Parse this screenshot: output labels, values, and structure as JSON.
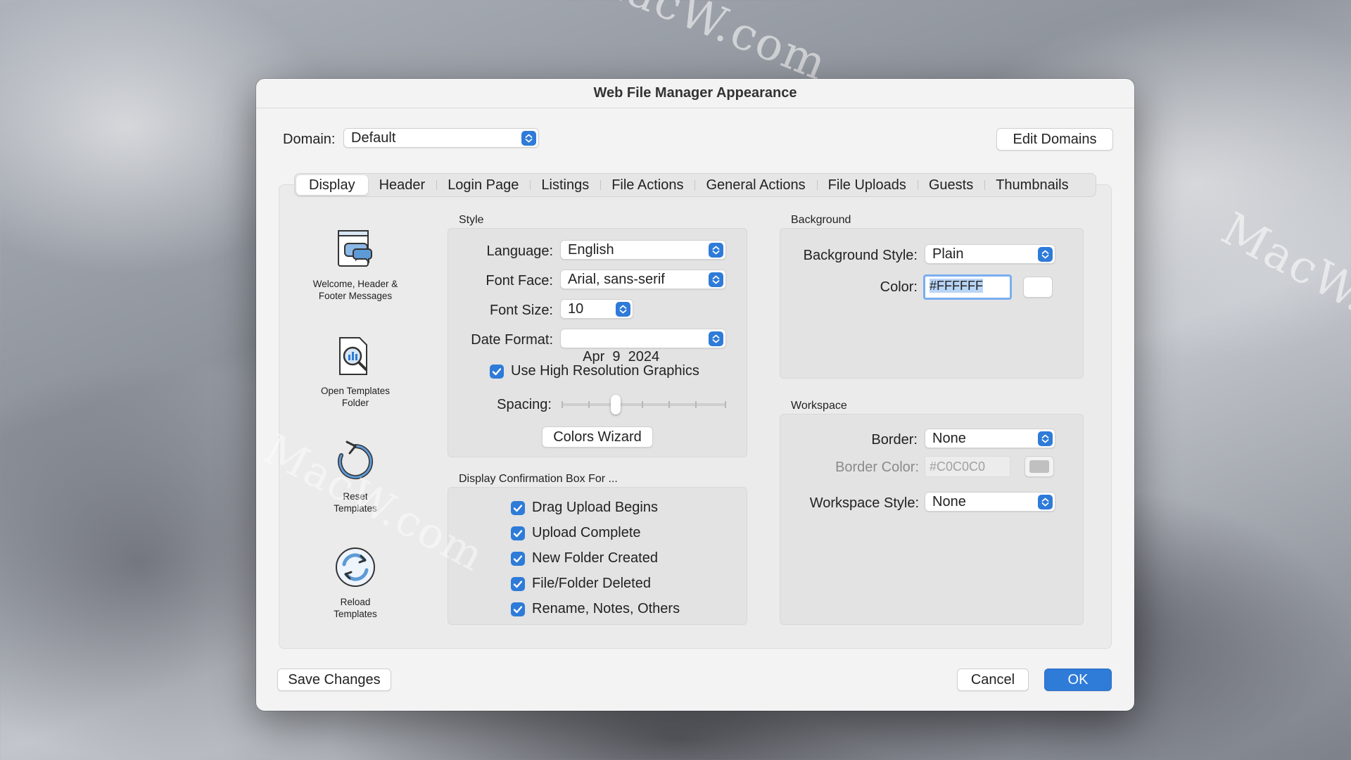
{
  "watermark": "MacW.com",
  "dialog": {
    "title": "Web File Manager Appearance",
    "domain_label": "Domain:",
    "domain_value": "Default",
    "edit_domains": "Edit Domains",
    "tabs": [
      "Display",
      "Header",
      "Login Page",
      "Listings",
      "File Actions",
      "General Actions",
      "File Uploads",
      "Guests",
      "Thumbnails"
    ],
    "active_tab": "Display",
    "sidebar": [
      {
        "label_1": "Welcome, Header &",
        "label_2": "Footer Messages",
        "icon": "welcome-messages-icon"
      },
      {
        "label_1": "Open Templates",
        "label_2": "Folder",
        "icon": "open-templates-icon"
      },
      {
        "label_1": "Reset",
        "label_2": "Templates",
        "icon": "reset-templates-icon"
      },
      {
        "label_1": "Reload",
        "label_2": "Templates",
        "icon": "reload-templates-icon"
      }
    ],
    "style": {
      "title": "Style",
      "language_label": "Language:",
      "language_value": "English",
      "font_face_label": "Font Face:",
      "font_face_value": "Arial, sans-serif",
      "font_size_label": "Font Size:",
      "font_size_value": "10",
      "date_format_label": "Date Format:",
      "date_format_value": "Apr  9  2024",
      "high_res_label": "Use High Resolution Graphics",
      "high_res_checked": true,
      "spacing_label": "Spacing:",
      "spacing_level": 0.33,
      "colors_wizard": "Colors Wizard"
    },
    "confirm": {
      "title": "Display Confirmation Box For ...",
      "items": [
        "Drag Upload Begins",
        "Upload Complete",
        "New Folder Created",
        "File/Folder Deleted",
        "Rename, Notes, Others"
      ]
    },
    "background": {
      "title": "Background",
      "style_label": "Background Style:",
      "style_value": "Plain",
      "color_label": "Color:",
      "color_value": "#FFFFFF",
      "swatch": "#FFFFFF"
    },
    "workspace": {
      "title": "Workspace",
      "border_label": "Border:",
      "border_value": "None",
      "border_color_label": "Border Color:",
      "border_color_value": "#C0C0C0",
      "border_swatch": "#C0C0C0",
      "style_label": "Workspace Style:",
      "style_value": "None"
    },
    "save_changes": "Save Changes",
    "cancel": "Cancel",
    "ok": "OK",
    "accent": "#2E7BD8"
  }
}
